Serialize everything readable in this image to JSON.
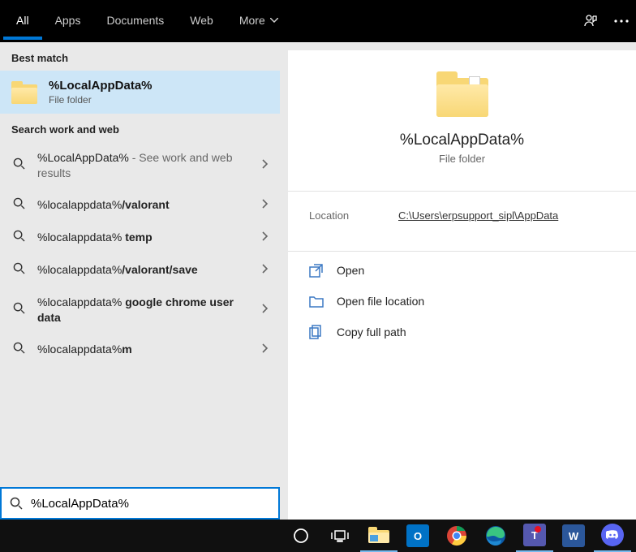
{
  "topbar": {
    "tabs": [
      "All",
      "Apps",
      "Documents",
      "Web",
      "More"
    ],
    "active_index": 0
  },
  "left": {
    "best_match_label": "Best match",
    "best_match": {
      "title": "%LocalAppData%",
      "subtitle": "File folder"
    },
    "search_section_label": "Search work and web",
    "results": [
      {
        "prefix": "%LocalAppData%",
        "suffix": " - See work and web results",
        "bold_suffix": false
      },
      {
        "prefix": "%localappdata%",
        "suffix": "/valorant",
        "bold_suffix": true
      },
      {
        "prefix": "%localappdata% ",
        "suffix": "temp",
        "bold_suffix": true
      },
      {
        "prefix": "%localappdata%",
        "suffix": "/valorant/save",
        "bold_suffix": true
      },
      {
        "prefix": "%localappdata% ",
        "suffix": "google chrome user data",
        "bold_suffix": true
      },
      {
        "prefix": "%localappdata%",
        "suffix": "m",
        "bold_suffix": true
      }
    ]
  },
  "preview": {
    "title": "%LocalAppData%",
    "subtitle": "File folder",
    "location_label": "Location",
    "location_path": "C:\\Users\\erpsupport_sipl\\AppData",
    "actions": [
      "Open",
      "Open file location",
      "Copy full path"
    ]
  },
  "search_input": {
    "value": "%LocalAppData%"
  },
  "taskbar": {
    "apps": [
      {
        "name": "cortana",
        "glyph": "circle",
        "color": "#fff"
      },
      {
        "name": "task-view",
        "glyph": "taskview",
        "color": "#fff"
      },
      {
        "name": "file-explorer",
        "glyph": "folder",
        "color": "#f8d775"
      },
      {
        "name": "outlook",
        "glyph": "O",
        "color": "#fff",
        "bg": "#0072c6"
      },
      {
        "name": "chrome",
        "glyph": "chrome",
        "color": "#fff"
      },
      {
        "name": "edge",
        "glyph": "edge",
        "color": "#fff"
      },
      {
        "name": "teams",
        "glyph": "T",
        "color": "#fff",
        "bg": "#5558af"
      },
      {
        "name": "word",
        "glyph": "W",
        "color": "#fff",
        "bg": "#2b579a"
      },
      {
        "name": "discord",
        "glyph": "discord",
        "color": "#fff",
        "bg": "#5865F2"
      }
    ]
  }
}
